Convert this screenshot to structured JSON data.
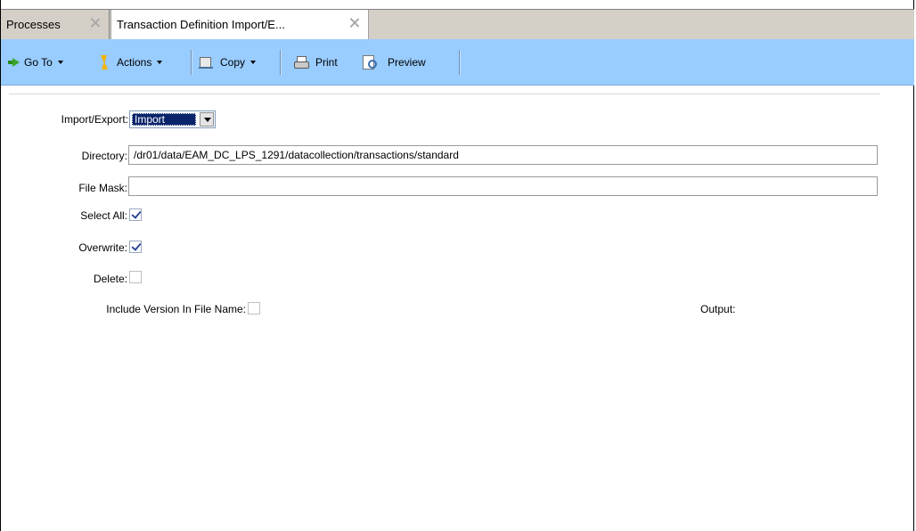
{
  "tabs": [
    {
      "label": "Processes",
      "active": false
    },
    {
      "label": "Transaction Definition Import/E...",
      "active": true
    }
  ],
  "toolbar": {
    "goto_label": "Go To",
    "actions_label": "Actions",
    "copy_label": "Copy",
    "print_label": "Print",
    "preview_label": "Preview",
    "background_color": "#99ccff"
  },
  "form": {
    "import_export": {
      "label": "Import/Export:",
      "value": "Import"
    },
    "directory": {
      "label": "Directory:",
      "value": "/dr01/data/EAM_DC_LPS_1291/datacollection/transactions/standard"
    },
    "file_mask": {
      "label": "File Mask:",
      "value": ""
    },
    "select_all": {
      "label": "Select All:",
      "checked": true
    },
    "overwrite": {
      "label": "Overwrite:",
      "checked": true
    },
    "delete": {
      "label": "Delete:",
      "checked": false
    },
    "include_version": {
      "label": "Include Version In File Name:",
      "checked": false
    },
    "output": {
      "label": "Output:"
    }
  }
}
